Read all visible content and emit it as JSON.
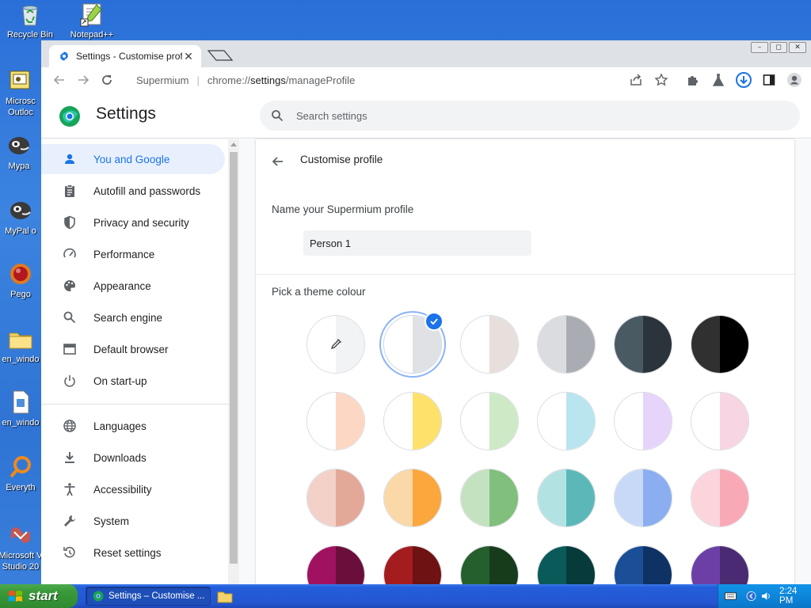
{
  "desktop": {
    "icons": [
      {
        "label": "Recycle Bin"
      },
      {
        "label": "Notepad++"
      },
      {
        "label": "Microsc Outloc"
      },
      {
        "label": "Mypa"
      },
      {
        "label": "MyPal o"
      },
      {
        "label": "Pego"
      },
      {
        "label": "en_windo"
      },
      {
        "label": "en_windo"
      },
      {
        "label": "Everyth"
      },
      {
        "label": "Microsoft V Studio 20"
      }
    ]
  },
  "browser": {
    "tab_title": "Settings - Customise profil",
    "tab_close": "✕",
    "window_buttons": {
      "minimize": "–",
      "restore": "◻",
      "close": "✕"
    },
    "omnibox": {
      "site_name": "Supermium",
      "url_scheme": "chrome://",
      "url_host": "settings",
      "url_path": "/manageProfile"
    }
  },
  "settings": {
    "title": "Settings",
    "search_placeholder": "Search settings",
    "nav": [
      {
        "label": "You and Google",
        "icon": "person-icon",
        "active": true
      },
      {
        "label": "Autofill and passwords",
        "icon": "clipboard-icon"
      },
      {
        "label": "Privacy and security",
        "icon": "shield-icon"
      },
      {
        "label": "Performance",
        "icon": "speedometer-icon"
      },
      {
        "label": "Appearance",
        "icon": "palette-icon"
      },
      {
        "label": "Search engine",
        "icon": "search-icon"
      },
      {
        "label": "Default browser",
        "icon": "browser-window-icon"
      },
      {
        "label": "On start-up",
        "icon": "power-icon"
      },
      {
        "label": "Languages",
        "icon": "globe-icon"
      },
      {
        "label": "Downloads",
        "icon": "download-icon"
      },
      {
        "label": "Accessibility",
        "icon": "accessibility-icon"
      },
      {
        "label": "System",
        "icon": "wrench-icon"
      },
      {
        "label": "Reset settings",
        "icon": "reset-icon"
      }
    ],
    "customise": {
      "subpage_title": "Customise profile",
      "name_label": "Name your Supermium profile",
      "name_value": "Person 1",
      "theme_label": "Pick a theme colour",
      "selected_swatch": 1,
      "swatches": [
        [
          "#ffffff",
          "#f1f3f4"
        ],
        [
          "#ffffff",
          "#dfe1e5"
        ],
        [
          "#ffffff",
          "#e6dfdc"
        ],
        [
          "#dadce0",
          "#a9adb3"
        ],
        [
          "#4a5a63",
          "#2b343a"
        ],
        [
          "#303030",
          "#000000"
        ],
        [
          "#ffffff",
          "#fbd7c4"
        ],
        [
          "#ffffff",
          "#fde16a"
        ],
        [
          "#ffffff",
          "#cde9c6"
        ],
        [
          "#ffffff",
          "#b8e5ee"
        ],
        [
          "#ffffff",
          "#e6d4fb"
        ],
        [
          "#ffffff",
          "#f7d5e3"
        ],
        [
          "#f3d0c8",
          "#e3a898"
        ],
        [
          "#fbd8a8",
          "#fba73e"
        ],
        [
          "#c4e2c0",
          "#80bf7c"
        ],
        [
          "#b3e2e2",
          "#5cb8b8"
        ],
        [
          "#c8d9f7",
          "#8aaef0"
        ],
        [
          "#fcd5dc",
          "#f9a8b6"
        ],
        [
          "#a01260",
          "#6a0f3b"
        ],
        [
          "#a51c1f",
          "#6e1213"
        ],
        [
          "#255f2d",
          "#173c1c"
        ],
        [
          "#0a5a5a",
          "#073a3a"
        ],
        [
          "#1a4f98",
          "#0f3264"
        ],
        [
          "#6c3fa6",
          "#4a2a72"
        ]
      ]
    }
  },
  "taskbar": {
    "start_label": "start",
    "task_label": "Settings – Customise ...",
    "clock": "2:24 PM"
  }
}
